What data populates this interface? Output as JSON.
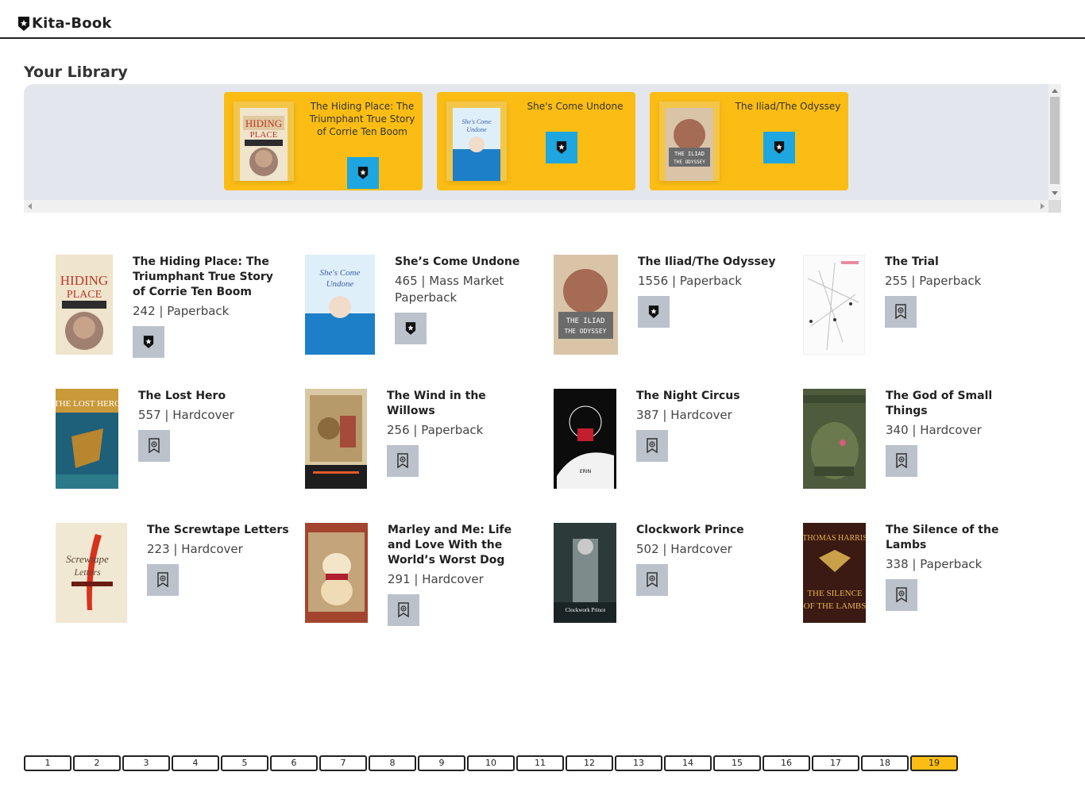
{
  "app": {
    "name": "Kita-Book",
    "logo_icon": "shield-star-icon"
  },
  "library": {
    "title": "Your Library",
    "cards": [
      {
        "title": "The Hiding Place: The Triumphant True Story of Corrie Ten Boom",
        "button_icon": "shield-star-icon"
      },
      {
        "title": "She's Come Undone",
        "button_icon": "shield-star-icon"
      },
      {
        "title": "The Iliad/The Odyssey",
        "button_icon": "shield-star-icon"
      }
    ]
  },
  "books": [
    {
      "title": "The Hiding Place: The Triumphant True Story of Corrie Ten Boom",
      "meta": "242 | Paperback",
      "in_library": true
    },
    {
      "title": "She’s Come Undone",
      "meta": "465 | Mass Market Paperback",
      "in_library": true
    },
    {
      "title": "The Iliad/The Odyssey",
      "meta": "1556 | Paperback",
      "in_library": true
    },
    {
      "title": "The Trial",
      "meta": "255 | Paperback",
      "in_library": false
    },
    {
      "title": "The Lost Hero",
      "meta": "557 | Hardcover",
      "in_library": false
    },
    {
      "title": "The Wind in the Willows",
      "meta": "256 | Paperback",
      "in_library": false
    },
    {
      "title": "The Night Circus",
      "meta": "387 | Hardcover",
      "in_library": false
    },
    {
      "title": "The God of Small Things",
      "meta": "340 | Hardcover",
      "in_library": false
    },
    {
      "title": "The Screwtape Letters",
      "meta": "223 | Hardcover",
      "in_library": false
    },
    {
      "title": "Marley and Me: Life and Love With the World’s Worst Dog",
      "meta": "291 | Hardcover",
      "in_library": false
    },
    {
      "title": "Clockwork Prince",
      "meta": "502 | Hardcover",
      "in_library": false
    },
    {
      "title": "The Silence of the Lambs",
      "meta": "338 | Paperback",
      "in_library": false
    }
  ],
  "colors": {
    "accent": "#fbbd14",
    "library_button": "#1ea6e0",
    "book_button": "#bbc2cb",
    "panel": "#e3e6ec"
  },
  "pagination": {
    "pages": [
      "1",
      "2",
      "3",
      "4",
      "5",
      "6",
      "7",
      "8",
      "9",
      "10",
      "11",
      "12",
      "13",
      "14",
      "15",
      "16",
      "17",
      "18",
      "19"
    ],
    "current": "19"
  }
}
